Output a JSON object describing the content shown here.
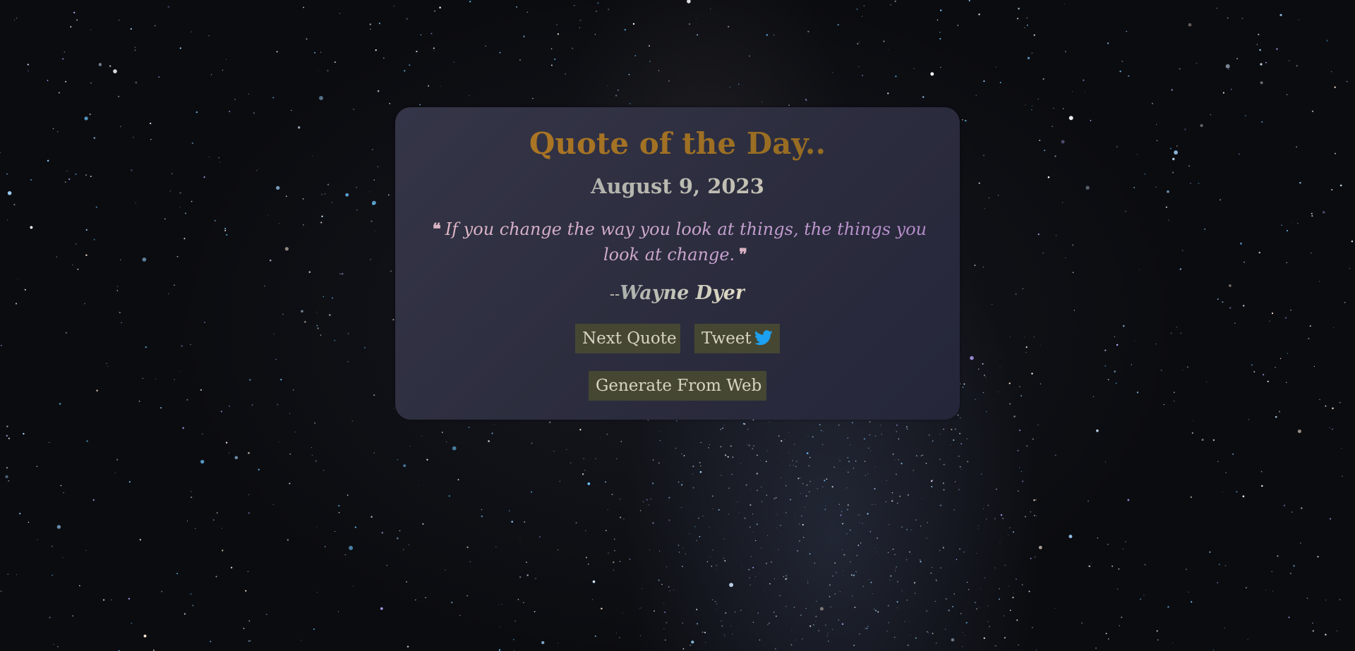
{
  "card": {
    "title": "Quote of the Day..",
    "date": "August 9, 2023",
    "quote": {
      "open_mark": "❝",
      "text": "If you change the way you look at things, the things you look at change.",
      "close_mark": "❞"
    },
    "author": {
      "prefix": "--",
      "name": "Wayne Dyer"
    }
  },
  "buttons": {
    "next_label": "Next Quote",
    "tweet_label": "Tweet",
    "tweet_icon": "twitter-icon",
    "web_label": "Generate From Web"
  },
  "colors": {
    "title_accent": "#b57a25",
    "button_bg": "#454733",
    "twitter_blue": "#1da1f2"
  }
}
